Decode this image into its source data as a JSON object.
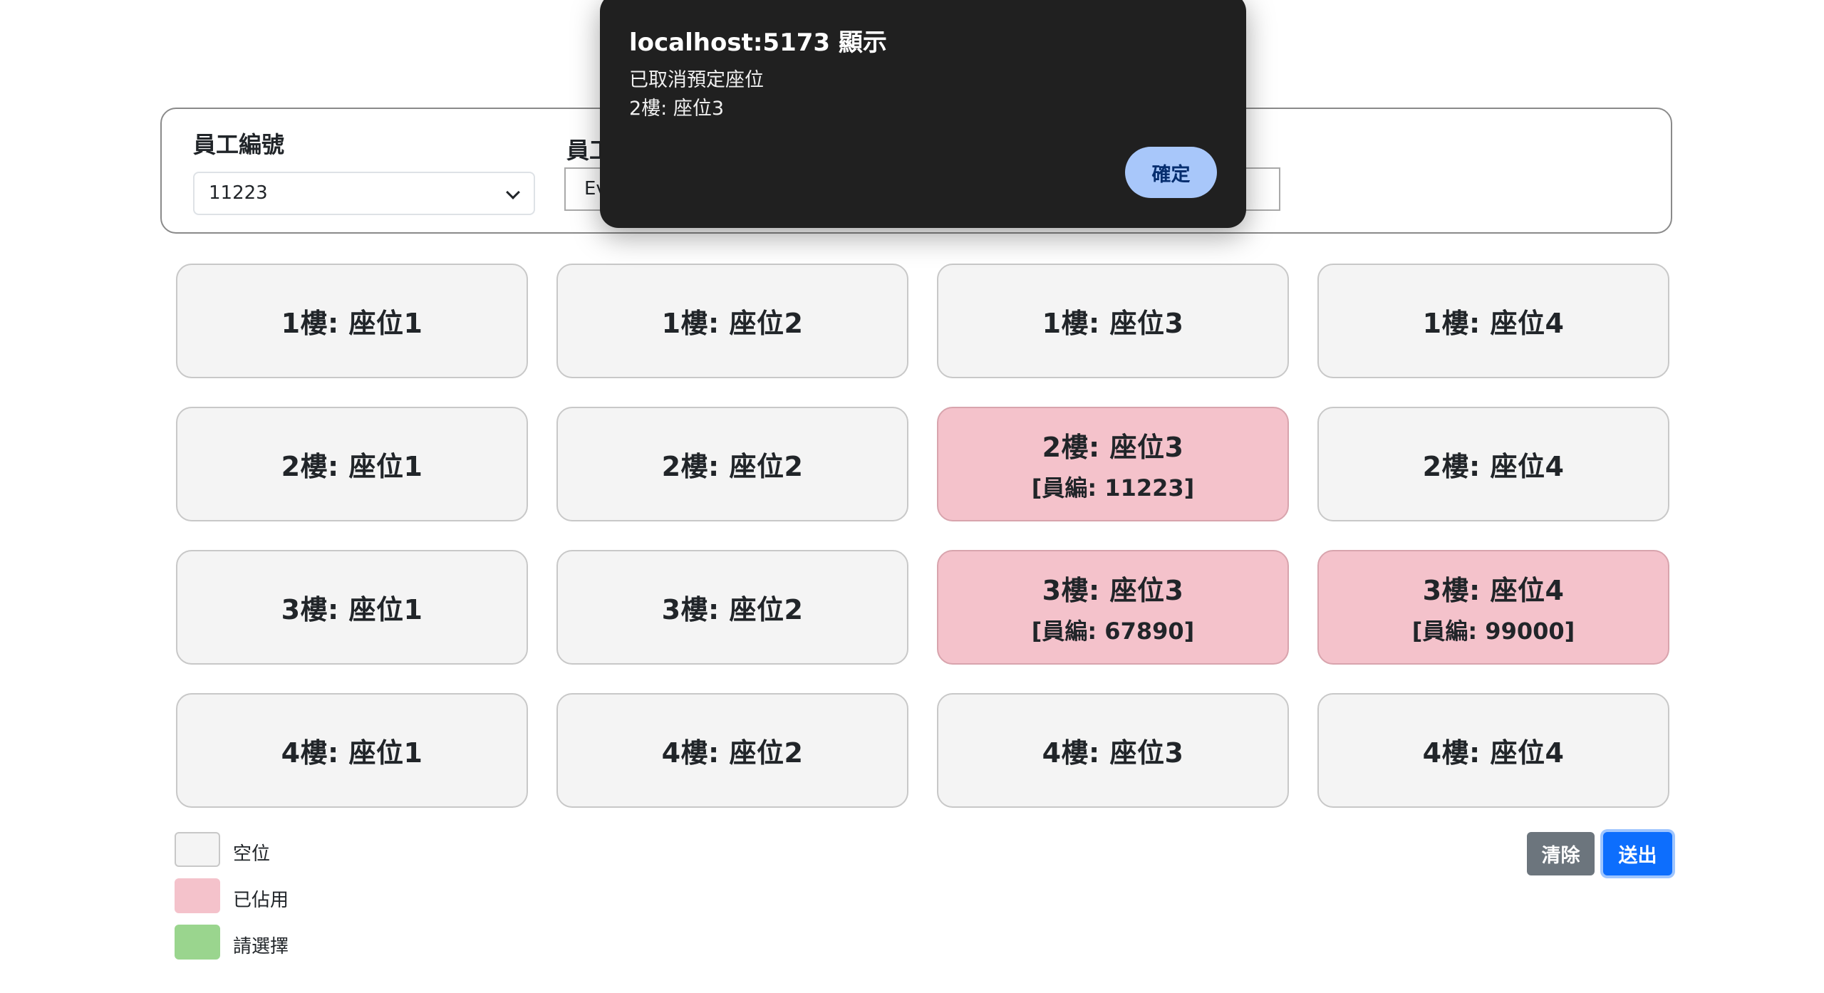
{
  "form": {
    "employee_id_label": "員工編號",
    "employee_id_value": "11223",
    "employee_name_label_partial": "員工",
    "employee_name_value_partial": "Ev"
  },
  "seats": [
    {
      "label": "1樓: 座位1",
      "status": "empty",
      "employee": ""
    },
    {
      "label": "1樓: 座位2",
      "status": "empty",
      "employee": ""
    },
    {
      "label": "1樓: 座位3",
      "status": "empty",
      "employee": ""
    },
    {
      "label": "1樓: 座位4",
      "status": "empty",
      "employee": ""
    },
    {
      "label": "2樓: 座位1",
      "status": "empty",
      "employee": ""
    },
    {
      "label": "2樓: 座位2",
      "status": "empty",
      "employee": ""
    },
    {
      "label": "2樓: 座位3",
      "status": "occupied",
      "employee": "[員編: 11223]"
    },
    {
      "label": "2樓: 座位4",
      "status": "empty",
      "employee": ""
    },
    {
      "label": "3樓: 座位1",
      "status": "empty",
      "employee": ""
    },
    {
      "label": "3樓: 座位2",
      "status": "empty",
      "employee": ""
    },
    {
      "label": "3樓: 座位3",
      "status": "occupied",
      "employee": "[員編: 67890]"
    },
    {
      "label": "3樓: 座位4",
      "status": "occupied",
      "employee": "[員編: 99000]"
    },
    {
      "label": "4樓: 座位1",
      "status": "empty",
      "employee": ""
    },
    {
      "label": "4樓: 座位2",
      "status": "empty",
      "employee": ""
    },
    {
      "label": "4樓: 座位3",
      "status": "empty",
      "employee": ""
    },
    {
      "label": "4樓: 座位4",
      "status": "empty",
      "employee": ""
    }
  ],
  "legend": [
    {
      "label": "空位",
      "color": "#f4f4f4"
    },
    {
      "label": "已佔用",
      "color": "#f4c2cb"
    },
    {
      "label": "請選擇",
      "color": "#9ad58e"
    }
  ],
  "buttons": {
    "clear": "清除",
    "submit": "送出"
  },
  "dialog": {
    "title": "localhost:5173 顯示",
    "line1": "已取消預定座位",
    "line2": "2樓: 座位3",
    "ok": "確定"
  }
}
